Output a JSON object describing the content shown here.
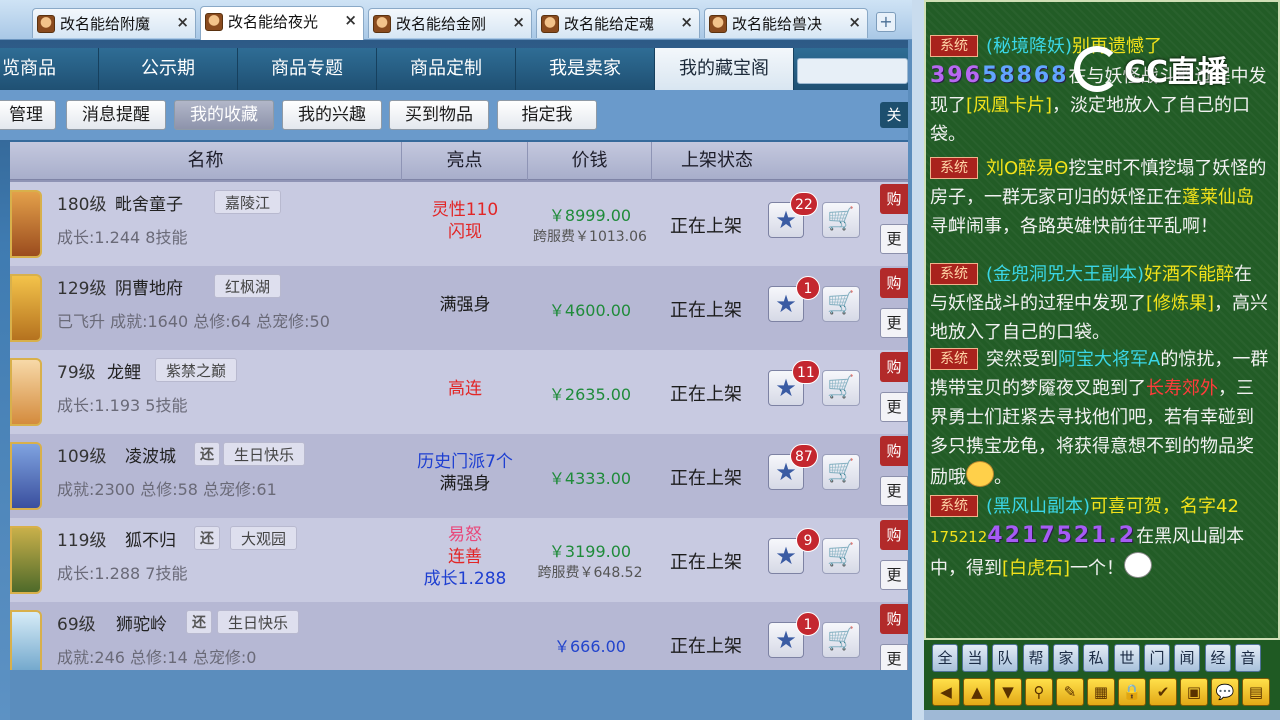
{
  "tabs": [
    {
      "label": "改名能给附魔",
      "active": false
    },
    {
      "label": "改名能给夜光",
      "active": true
    },
    {
      "label": "改名能给金刚",
      "active": false
    },
    {
      "label": "改名能给定魂",
      "active": false
    },
    {
      "label": "改名能给兽决",
      "active": false
    }
  ],
  "tab_close": "×",
  "tab_add": "+",
  "nav": [
    {
      "label": "览商品"
    },
    {
      "label": "公示期"
    },
    {
      "label": "商品专题"
    },
    {
      "label": "商品定制"
    },
    {
      "label": "我是卖家"
    },
    {
      "label": "我的藏宝阁",
      "active": true
    }
  ],
  "subnav": [
    {
      "label": "管理"
    },
    {
      "label": "消息提醒"
    },
    {
      "label": "我的收藏",
      "active": true
    },
    {
      "label": "我的兴趣"
    },
    {
      "label": "买到物品"
    },
    {
      "label": "指定我"
    }
  ],
  "subnav_right": "关",
  "columns": {
    "name": "名称",
    "highlight": "亮点",
    "price": "价钱",
    "status": "上架状态"
  },
  "rows": [
    {
      "level": "180级",
      "name": "毗舍童子",
      "huan": "",
      "server": "嘉陵江",
      "sub": "成长:1.244 8技能",
      "highlights": [
        {
          "text": "灵性110",
          "color": "red"
        },
        {
          "text": "闪现",
          "color": "red"
        }
      ],
      "price": "￥8999.00",
      "fee": "跨服费￥1013.06",
      "status": "正在上架",
      "favorites": "22"
    },
    {
      "level": "129级",
      "name": "阴曹地府",
      "huan": "",
      "server": "红枫湖",
      "sub": "已飞升 成就:1640 总修:64 总宠修:50",
      "highlights": [
        {
          "text": "满强身",
          "color": "black"
        }
      ],
      "price": "￥4600.00",
      "fee": "",
      "status": "正在上架",
      "favorites": "1"
    },
    {
      "level": "79级",
      "name": "龙鲤",
      "huan": "",
      "server": "紫禁之巅",
      "sub": "成长:1.193 5技能",
      "highlights": [
        {
          "text": "高连",
          "color": "red"
        }
      ],
      "price": "￥2635.00",
      "fee": "",
      "status": "正在上架",
      "favorites": "11"
    },
    {
      "level": "109级",
      "name": "凌波城",
      "huan": "还",
      "server": "生日快乐",
      "sub": "成就:2300 总修:58 总宠修:61",
      "highlights": [
        {
          "text": "历史门派7个",
          "color": "blue"
        },
        {
          "text": "满强身",
          "color": "black"
        }
      ],
      "price": "￥4333.00",
      "fee": "",
      "status": "正在上架",
      "favorites": "87"
    },
    {
      "level": "119级",
      "name": "狐不归",
      "huan": "还",
      "server": "大观园",
      "sub": "成长:1.288 7技能",
      "highlights": [
        {
          "text": "易怒",
          "color": "pink"
        },
        {
          "text": "连善",
          "color": "red"
        },
        {
          "text": "成长1.288",
          "color": "blue"
        }
      ],
      "price": "￥3199.00",
      "fee": "跨服费￥648.52",
      "status": "正在上架",
      "favorites": "9"
    },
    {
      "level": "69级",
      "name": "狮驼岭",
      "huan": "还",
      "server": "生日快乐",
      "sub": "成就:246 总修:14 总宠修:0",
      "highlights": [],
      "price": "￥666.00",
      "fee": "",
      "status": "正在上架",
      "favorites": "1",
      "price_blue": true
    }
  ],
  "row_buttons": {
    "buy": "购",
    "more": "更"
  },
  "icons": {
    "star": "star-icon",
    "cart": "cart-icon"
  },
  "chat": {
    "sys_label": "系统",
    "m1": {
      "a": "(秘境降妖)",
      "b": "别再遗憾了",
      "c": "396",
      "d": "58868",
      "e": "在与妖怪战斗的过程中发现了",
      "f": "[凤凰卡片]",
      "g": "，淡定地放入了自己的口袋。"
    },
    "m2": {
      "a": "刘O醉易Θ",
      "b": "挖宝时不慎挖塌了妖怪的房子，一群无家可归的妖怪正在",
      "c": "蓬莱仙岛",
      "d": "寻衅闹事，各路英雄快前往平乱啊！"
    },
    "m3": {
      "a": "(金兜洞兕大王副本)",
      "b": "好酒不能醉",
      "c": "在与妖怪战斗的过程中发现了",
      "d": "[修炼果]",
      "e": "，高兴地放入了自己的口袋。"
    },
    "m4": {
      "a": "突然受到",
      "b": "阿宝大将军A",
      "c": "的惊扰，一群携带宝贝的梦魇夜叉跑到了",
      "d": "长寿郊外",
      "e": "，三界勇士们赶紧去寻找他们吧，若有幸碰到多只携宝龙龟，将获得意想不到的物品奖励哦",
      "f": "。"
    },
    "m5": {
      "a": "(黑风山副本)",
      "b": "可喜可贺，",
      "c": "名字42",
      "d": "175212",
      "e": "4217521.2",
      "f": "在黑风山副本中，得到",
      "g": "[白虎石]",
      "h": "一个！"
    },
    "logo": "CC直播"
  },
  "channels": [
    "全",
    "当",
    "队",
    "帮",
    "家",
    "私",
    "世",
    "门",
    "闻",
    "经",
    "音"
  ],
  "tools": [
    "◀",
    "▲",
    "▼",
    "⚲",
    "✎",
    "▦",
    "🔒",
    "✔",
    "▣",
    "💬",
    "▤"
  ],
  "colors": {
    "accent": "#2f6d95",
    "price_green": "#1f8b3a",
    "badge_red": "#c4272f",
    "chat_bg": "#225c26"
  }
}
